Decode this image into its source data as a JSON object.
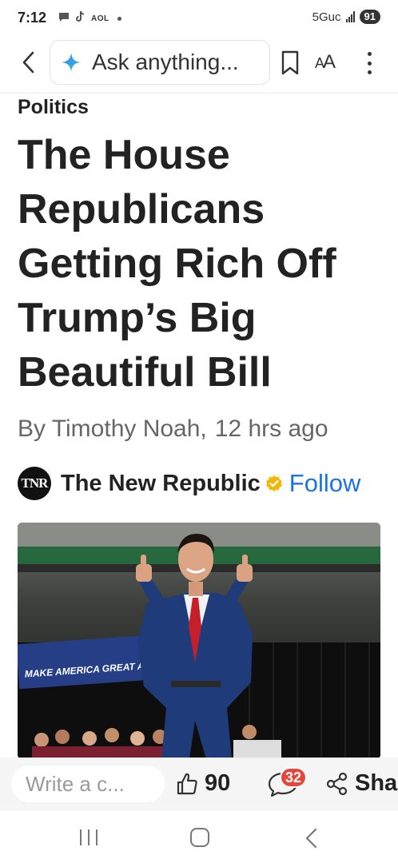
{
  "status_bar": {
    "time": "7:12",
    "aol": "AOL",
    "network": "5Guc",
    "battery": "91"
  },
  "toolbar": {
    "search_placeholder": "Ask anything...",
    "text_size_label_big": "A",
    "text_size_label_small": "A"
  },
  "article": {
    "category": "Politics",
    "headline": "The House Republicans Getting Rich Off Trump’s Big Beautiful Bill",
    "author": "By Timothy Noah,",
    "time_ago": "12 hrs ago"
  },
  "publisher": {
    "logo_text": "TNR",
    "name": "The New Republic",
    "follow_label": "Follow"
  },
  "hero_image": {
    "banner_text": "MAKE AMERICA GREAT AGAI"
  },
  "engagement": {
    "comment_placeholder": "Write a c...",
    "likes": "90",
    "comments": "32",
    "share_label": "Sha"
  },
  "colors": {
    "accent": "#1a73e8",
    "badge": "#e8453c",
    "verified": "#f2b705"
  }
}
